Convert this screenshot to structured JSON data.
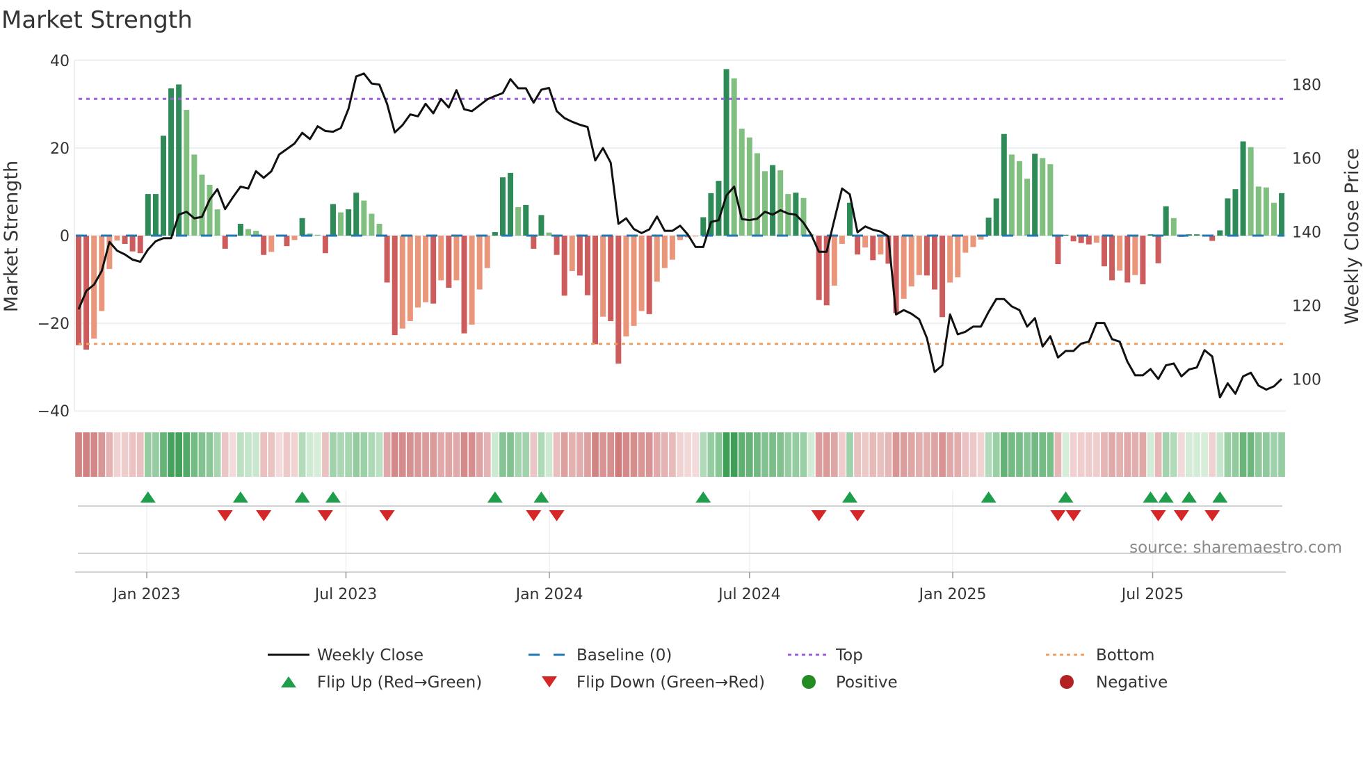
{
  "chart_data": {
    "type": "bar",
    "title": "Market Strength",
    "ylabel": "Market Strength",
    "y2label": "Weekly Close Price",
    "ylim": [
      -40,
      40
    ],
    "y2lim": [
      91.5,
      183
    ],
    "y_ticks": [
      {
        "v": 40,
        "label": "40"
      },
      {
        "v": 20,
        "label": "20"
      },
      {
        "v": 0,
        "label": "0"
      },
      {
        "v": -20,
        "label": "−20"
      },
      {
        "v": -40,
        "label": "−40"
      }
    ],
    "y2_ticks": [
      {
        "v": 180,
        "label": "180"
      },
      {
        "v": 160,
        "label": "160"
      },
      {
        "v": 140,
        "label": "140"
      },
      {
        "v": 120,
        "label": "120"
      },
      {
        "v": 100,
        "label": "100"
      }
    ],
    "x_ticks": [
      {
        "week": 8.84,
        "label": "Jan 2023"
      },
      {
        "week": 34.67,
        "label": "Jul 2023"
      },
      {
        "week": 61.05,
        "label": "Jan 2024"
      },
      {
        "week": 87.0,
        "label": "Jul 2024"
      },
      {
        "week": 113.35,
        "label": "Jan 2025"
      },
      {
        "week": 139.27,
        "label": "Jul 2025"
      }
    ],
    "top_level": 31.2,
    "bottom_level": -24.7,
    "baseline": 0,
    "strength": [
      -25,
      -26,
      -23.5,
      -17.2,
      -7.6,
      -1.1,
      -1.9,
      -3.6,
      -4,
      9.5,
      9.5,
      22.8,
      33.6,
      34.5,
      28.7,
      18.5,
      13.9,
      11.6,
      6,
      -3,
      -0.2,
      2.7,
      1.5,
      1.1,
      -4.4,
      -3.7,
      -0.2,
      -2.4,
      -1,
      4,
      0.5,
      0.2,
      -4,
      7.2,
      5.3,
      6,
      9.8,
      8,
      5,
      2.7,
      -10.7,
      -22.7,
      -21.2,
      -19.5,
      -16.4,
      -15.2,
      -15.5,
      -10.2,
      -11.9,
      -10.2,
      -22.3,
      -20.3,
      -12.3,
      -7.4,
      0.8,
      13.3,
      14.3,
      6.5,
      7,
      -3,
      4.7,
      0.7,
      -4.4,
      -13.7,
      -8.1,
      -9.1,
      -13.6,
      -24.8,
      -18.5,
      -19.5,
      -29.2,
      -23,
      -20.6,
      -17.2,
      -17.9,
      -10.5,
      -7.4,
      -5.5,
      -1,
      -0.4,
      -0.2,
      4.2,
      9.7,
      12.5,
      38,
      35.9,
      24.4,
      22.4,
      18.8,
      14.7,
      16.1,
      14.9,
      9.5,
      9.8,
      8.6,
      0.3,
      -14.7,
      -15.9,
      -11.4,
      -1.9,
      7.5,
      -4.3,
      -2.7,
      -5.6,
      -4.3,
      -6.4,
      -17.7,
      -14.4,
      -11.6,
      -9,
      -9.1,
      -12.3,
      -18.6,
      -10.7,
      -9.5,
      -3.9,
      -2.6,
      -0.9,
      4.1,
      8.5,
      23.2,
      18.5,
      17,
      13,
      18.7,
      17.7,
      16.3,
      -6.5,
      0.2,
      -1.3,
      -1.7,
      -2,
      -1.6,
      -7,
      -10.2,
      -8,
      -10.7,
      -9,
      -11.1,
      0.3,
      -6.3,
      6.7,
      4,
      -0.3,
      0.3,
      0.3,
      0.2,
      -1.2,
      1.2,
      8.5,
      10.6,
      21.5,
      20.2,
      11.2,
      11,
      7.5,
      9.7
    ],
    "weekly_close": [
      119.0,
      124.0,
      125.7,
      129.4,
      137.3,
      134.9,
      133.9,
      132.5,
      131.9,
      135.2,
      137.5,
      138.3,
      138.3,
      144.7,
      145.5,
      143.7,
      144.1,
      148.8,
      151.6,
      146.2,
      149.4,
      152.3,
      151.8,
      156.5,
      154.7,
      156.5,
      161,
      162.5,
      164,
      166.9,
      165.2,
      168.7,
      167.4,
      167.2,
      168.2,
      173.4,
      182.2,
      183,
      180.3,
      180,
      174.8,
      167,
      169,
      171.9,
      171.4,
      174.8,
      172.2,
      176.1,
      173.8,
      178.5,
      173.3,
      172.8,
      174.4,
      176,
      176.9,
      177.7,
      181.5,
      179,
      179,
      175.1,
      178.6,
      179.1,
      172.8,
      170.9,
      169.9,
      169.1,
      168.5,
      159.4,
      162.8,
      158.8,
      142.2,
      143.7,
      140.8,
      139.7,
      140.7,
      144.2,
      140.3,
      140.3,
      141.7,
      139.3,
      135.9,
      135.9,
      142.7,
      143.2,
      149.9,
      152.3,
      143.5,
      143.2,
      143.6,
      145.5,
      144.7,
      145.9,
      145,
      144.7,
      142.5,
      139.3,
      134.6,
      134.6,
      143.3,
      151.8,
      150.2,
      139.9,
      141.5,
      140.6,
      140.1,
      138.8,
      117.6,
      118.8,
      117.8,
      116.3,
      111.2,
      102,
      103.8,
      117.6,
      112.2,
      112.9,
      114.3,
      114.3,
      118.3,
      121.8,
      121.8,
      119.8,
      118.8,
      114.3,
      116.6,
      108.9,
      111.7,
      105.9,
      107.7,
      107.7,
      109.7,
      110.2,
      115.3,
      115.3,
      110.9,
      110.2,
      104.8,
      101.1,
      101.1,
      102.8,
      100.1,
      103.8,
      104.3,
      100.8,
      102.7,
      103.2,
      107.9,
      106.2,
      95.1,
      98.9,
      96.1,
      100.8,
      101.8,
      98.3,
      97.2,
      98.1,
      100.1
    ],
    "flip_up_weeks": [
      9,
      21,
      29,
      33,
      54,
      60,
      81,
      100,
      118,
      128,
      139,
      141,
      144,
      148
    ],
    "flip_down_weeks": [
      19,
      24,
      32,
      40,
      59,
      62,
      96,
      101,
      127,
      129,
      140,
      143,
      147
    ],
    "legend": [
      {
        "label": "Weekly Close",
        "kind": "line"
      },
      {
        "label": "Baseline (0)",
        "kind": "dash"
      },
      {
        "label": "Top",
        "kind": "dot-top"
      },
      {
        "label": "Bottom",
        "kind": "dot-bottom"
      },
      {
        "label": "Flip Up (Red→Green)",
        "kind": "tri-up"
      },
      {
        "label": "Flip Down (Green→Red)",
        "kind": "tri-down"
      },
      {
        "label": "Positive",
        "kind": "circle-pos"
      },
      {
        "label": "Negative",
        "kind": "circle-neg"
      }
    ],
    "legend_placement": "bottom",
    "grid": true,
    "source": "source: sharemaestro.com"
  },
  "colors": {
    "green_dark": "#2e8b57",
    "green_light": "#80bf80",
    "red_dark": "#cd5c5c",
    "red_light": "#e9967a",
    "price_line": "#111111",
    "baseline": "#1f77b4",
    "top": "#9b5fe0",
    "bottom": "#f0a060",
    "flip_up": "#1e9e4a",
    "flip_down": "#d62728",
    "positive": "#228b22",
    "negative": "#b22222"
  }
}
